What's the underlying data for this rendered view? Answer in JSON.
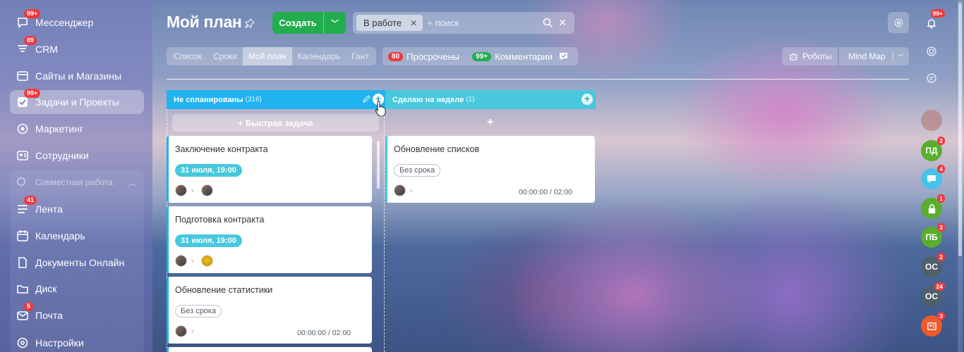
{
  "sidebar": {
    "items": [
      {
        "label": "Мессенджер",
        "badge": "99+",
        "icon": "messenger-icon"
      },
      {
        "label": "CRM",
        "badge": "89",
        "icon": "crm-icon"
      },
      {
        "label": "Сайты и Магазины",
        "badge": "",
        "icon": "sites-icon"
      },
      {
        "label": "Задачи и Проекты",
        "badge": "99+",
        "icon": "tasks-icon"
      },
      {
        "label": "Маркетинг",
        "badge": "",
        "icon": "marketing-icon"
      },
      {
        "label": "Сотрудники",
        "badge": "",
        "icon": "employees-icon"
      }
    ],
    "group_title": "Совместная работа",
    "group_items": [
      {
        "label": "Лента",
        "badge": "41",
        "icon": "feed-icon"
      },
      {
        "label": "Календарь",
        "badge": "",
        "icon": "calendar-icon"
      },
      {
        "label": "Документы Онлайн",
        "badge": "",
        "icon": "documents-icon"
      },
      {
        "label": "Диск",
        "badge": "",
        "icon": "disk-icon"
      },
      {
        "label": "Почта",
        "badge": "5",
        "icon": "mail-icon"
      }
    ],
    "settings_label": "Настройки"
  },
  "header": {
    "title": "Мой план",
    "create_label": "Создать",
    "filter_chip": "В работе",
    "search_placeholder": "+ поиск"
  },
  "view_tabs": [
    "Список",
    "Сроки",
    "Мой план",
    "Календарь",
    "Гант"
  ],
  "counters": {
    "overdue_count": "80",
    "overdue_label": "Просрочены",
    "comments_count": "99+",
    "comments_label": "Комментарии"
  },
  "toolbar": {
    "robots_label": "Роботы",
    "mindmap_label": "Mind Map"
  },
  "columns": [
    {
      "title": "Не спланированы",
      "count": "(316)",
      "quick_task": "+ Быстрая задача"
    },
    {
      "title": "Сделаю на неделе",
      "count": "(1)",
      "add": "+"
    }
  ],
  "cards": [
    {
      "title": "Заключение контракта",
      "deadline": "31 июля, 19:00"
    },
    {
      "title": "Подготовка контракта",
      "deadline": "31 июля, 19:00"
    },
    {
      "title": "Обновление статистики",
      "deadline": "Без срока",
      "timer": "00:00:00 / 02:00"
    },
    {
      "title": "Обновление списков",
      "deadline": "Без срока",
      "timer": "00:00:00 / 02:00"
    }
  ],
  "right_panel": {
    "notifications_badge": "99+",
    "contacts": [
      {
        "initials": "ПД",
        "badge": "2",
        "color": "#5aae2e"
      },
      {
        "initials": "",
        "badge": "4",
        "color": "#47c1e8",
        "icon": "chat-bubble-icon"
      },
      {
        "initials": "",
        "badge": "1",
        "color": "#5aae2e",
        "icon": "lock-icon"
      },
      {
        "initials": "ПБ",
        "badge": "3",
        "color": "#5aae2e"
      },
      {
        "initials": "ОС",
        "badge": "2",
        "color": "#50606b"
      },
      {
        "initials": "ОС",
        "badge": "24",
        "color": "#50606b"
      },
      {
        "initials": "",
        "badge": "3",
        "color": "#ef5a2a",
        "icon": "contact-card-icon"
      }
    ]
  },
  "colors": {
    "create_button": "#22ad4f",
    "column1_header": "#1fb3f0",
    "column2_header": "#48c8dd",
    "badge_red": "#f0383d",
    "badge_green": "#22ad4f"
  }
}
